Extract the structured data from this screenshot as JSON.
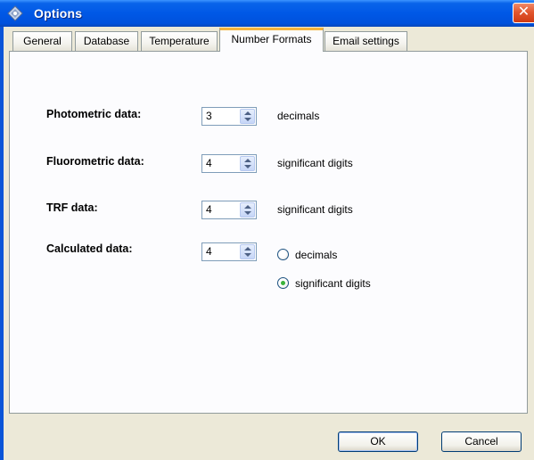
{
  "window": {
    "title": "Options",
    "close_label": "✕"
  },
  "tabs": [
    {
      "label": "General",
      "active": false
    },
    {
      "label": "Database",
      "active": false
    },
    {
      "label": "Temperature",
      "active": false
    },
    {
      "label": "Number Formats",
      "active": true
    },
    {
      "label": "Email settings",
      "active": false
    }
  ],
  "number_formats": {
    "photometric": {
      "label": "Photometric data:",
      "value": "3",
      "unit": "decimals"
    },
    "fluorometric": {
      "label": "Fluorometric data:",
      "value": "4",
      "unit": "significant digits"
    },
    "trf": {
      "label": "TRF data:",
      "value": "4",
      "unit": "significant digits"
    },
    "calculated": {
      "label": "Calculated data:",
      "value": "4",
      "options": [
        {
          "label": "decimals",
          "selected": false
        },
        {
          "label": "significant digits",
          "selected": true
        }
      ]
    }
  },
  "buttons": {
    "ok": "OK",
    "cancel": "Cancel"
  },
  "colors": {
    "titlebar": "#0058e6",
    "active_tab_accent": "#f5b43c",
    "dialog_bg": "#ece9d8",
    "radio_dot": "#3bb23b"
  }
}
